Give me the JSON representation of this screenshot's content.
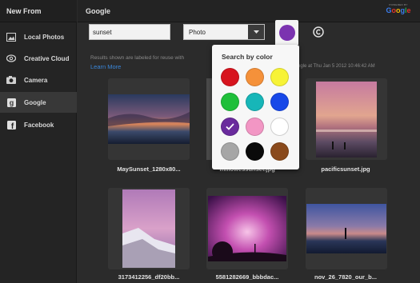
{
  "sidebar": {
    "title": "New From",
    "items": [
      {
        "label": "Local Photos",
        "icon": "image-icon"
      },
      {
        "label": "Creative Cloud",
        "icon": "creative-cloud-icon"
      },
      {
        "label": "Camera",
        "icon": "camera-icon"
      },
      {
        "label": "Google",
        "icon": "google-icon",
        "active": true
      },
      {
        "label": "Facebook",
        "icon": "facebook-icon"
      }
    ]
  },
  "header": {
    "title": "Google",
    "powered_by": "POWERED BY",
    "brand": "Google"
  },
  "toolbar": {
    "search_value": "sunset",
    "type_value": "Photo",
    "selected_color": "#7b33b0",
    "license_symbol": "©"
  },
  "info": {
    "text": "Results shown are labeled for reuse with",
    "right_text": "ogle at Thu Jan 5 2012 10:46:42 AM",
    "learn_more": "Learn More"
  },
  "color_popup": {
    "title": "Search by color",
    "colors": [
      {
        "name": "red",
        "hex": "#d7141e"
      },
      {
        "name": "orange",
        "hex": "#f5913a"
      },
      {
        "name": "yellow",
        "hex": "#f7f337"
      },
      {
        "name": "green",
        "hex": "#1fbf3a"
      },
      {
        "name": "teal",
        "hex": "#17b6b8"
      },
      {
        "name": "blue",
        "hex": "#1748e8"
      },
      {
        "name": "purple",
        "hex": "#6a2b9d",
        "selected": true
      },
      {
        "name": "pink",
        "hex": "#f296c4"
      },
      {
        "name": "white",
        "hex": "#ffffff"
      },
      {
        "name": "gray",
        "hex": "#a6a6a6"
      },
      {
        "name": "black",
        "hex": "#0a0a0a"
      },
      {
        "name": "brown",
        "hex": "#8a4a1c"
      }
    ]
  },
  "results": [
    {
      "caption": "MaySunset_1280x80..."
    },
    {
      "caption": "fhillowessunset.jpg"
    },
    {
      "caption": "pacificsunset.jpg"
    },
    {
      "caption": "3173412256_df20bb..."
    },
    {
      "caption": "5581282669_bbbdac..."
    },
    {
      "caption": "nov_26_7820_our_b..."
    }
  ]
}
